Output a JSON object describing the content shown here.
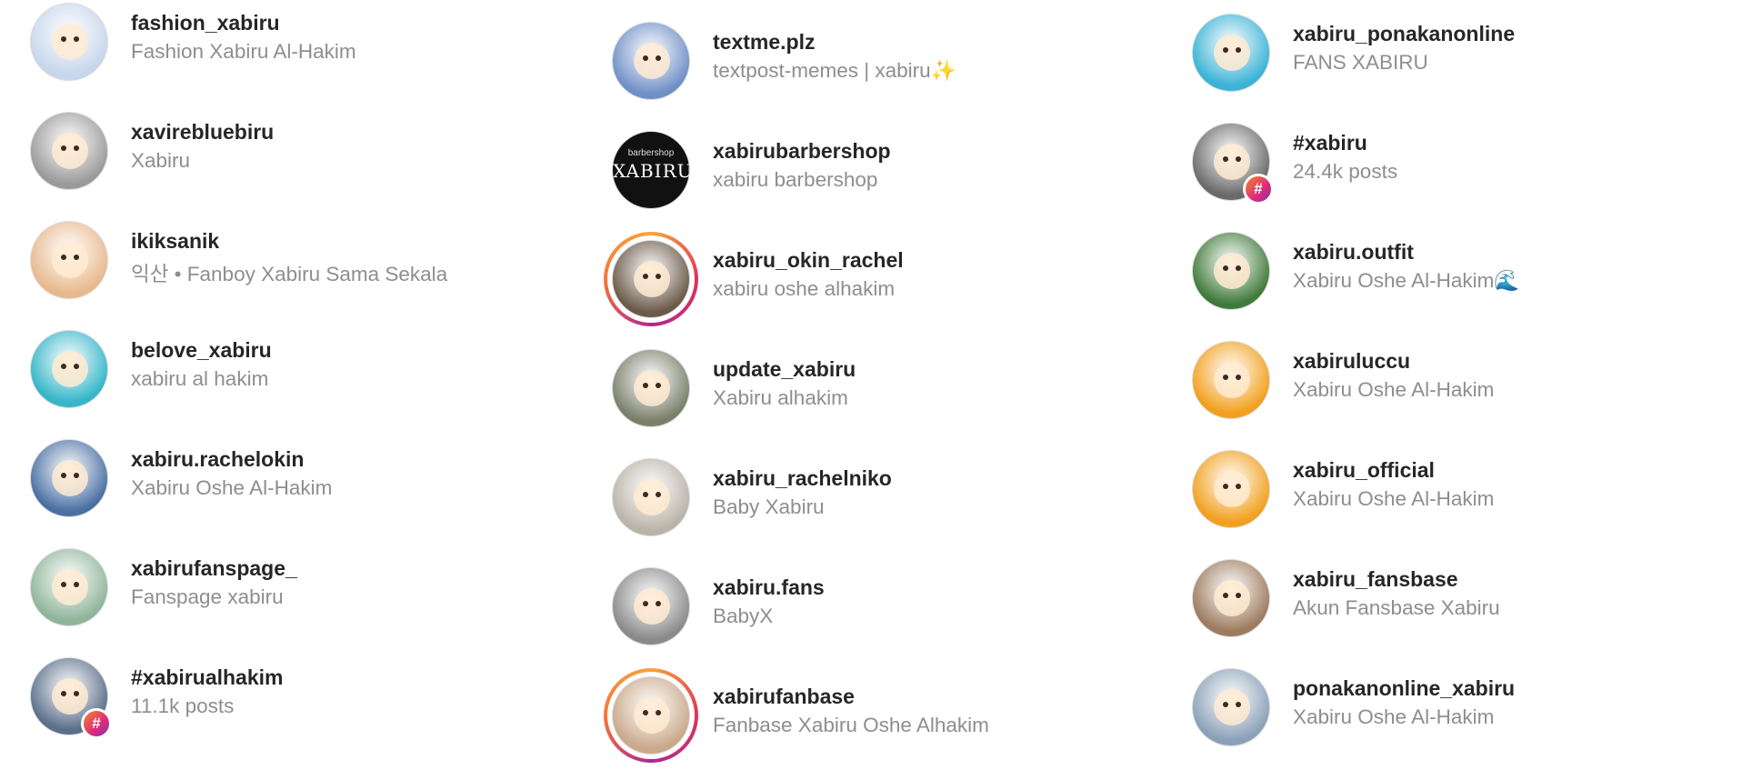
{
  "columns": [
    {
      "rows": [
        {
          "username": "fashion_xabiru",
          "subtitle": "Fashion Xabiru Al-Hakim",
          "avatar_color": "#c7d6ec",
          "avatar_kind": "photo"
        },
        {
          "username": "xavirebluebiru",
          "subtitle": "Xabiru",
          "avatar_color": "#9a9a9a",
          "avatar_kind": "photo"
        },
        {
          "username": "ikiksanik",
          "subtitle": "익산 • Fanboy Xabiru Sama Sekala",
          "avatar_color": "#e8b98d",
          "avatar_kind": "photo"
        },
        {
          "username": "belove_xabiru",
          "subtitle": "xabiru al hakim",
          "avatar_color": "#35b6c9",
          "avatar_kind": "photo"
        },
        {
          "username": "xabiru.rachelokin",
          "subtitle": "Xabiru Oshe Al-Hakim",
          "avatar_color": "#4a6fa3",
          "avatar_kind": "photo"
        },
        {
          "username": "xabirufanspage_",
          "subtitle": "Fanspage xabiru",
          "avatar_color": "#8fb59a",
          "avatar_kind": "photo"
        },
        {
          "username": "#xabirualhakim",
          "subtitle": "11.1k posts",
          "avatar_color": "#5b6f8a",
          "avatar_kind": "hashtag"
        }
      ]
    },
    {
      "rows": [
        {
          "username": "textme.plz",
          "subtitle": "textpost-memes | xabiru✨",
          "avatar_color": "#6f8fc7",
          "avatar_kind": "photo"
        },
        {
          "username": "xabirubarbershop",
          "subtitle": "xabiru barbershop",
          "avatar_color": "#111111",
          "avatar_kind": "logo",
          "logo_text": "XABIRU",
          "logo_small": "barbershop"
        },
        {
          "username": "xabiru_okin_rachel",
          "subtitle": "xabiru oshe alhakim",
          "avatar_color": "#6b5a4a",
          "avatar_kind": "story"
        },
        {
          "username": "update_xabiru",
          "subtitle": "Xabiru alhakim",
          "avatar_color": "#7a7f6a",
          "avatar_kind": "photo"
        },
        {
          "username": "xabiru_rachelniko",
          "subtitle": "Baby Xabiru",
          "avatar_color": "#b9b3a8",
          "avatar_kind": "photo"
        },
        {
          "username": "xabiru.fans",
          "subtitle": "BabyX",
          "avatar_color": "#8a8a8a",
          "avatar_kind": "photo"
        },
        {
          "username": "xabirufanbase",
          "subtitle": "Fanbase Xabiru Oshe Alhakim",
          "avatar_color": "#c9a98a",
          "avatar_kind": "story"
        }
      ]
    },
    {
      "rows": [
        {
          "username": "xabiru_ponakanonline",
          "subtitle": "FANS XABIRU",
          "avatar_color": "#3ab3d6",
          "avatar_kind": "photo"
        },
        {
          "username": "#xabiru",
          "subtitle": "24.4k posts",
          "avatar_color": "#6a6a6a",
          "avatar_kind": "hashtag"
        },
        {
          "username": "xabiru.outfit",
          "subtitle": "Xabiru Oshe Al-Hakim🌊",
          "avatar_color": "#3f7a3a",
          "avatar_kind": "photo"
        },
        {
          "username": "xabiruluccu",
          "subtitle": "Xabiru Oshe Al-Hakim",
          "avatar_color": "#f2a01e",
          "avatar_kind": "photo"
        },
        {
          "username": "xabiru_official",
          "subtitle": "Xabiru Oshe Al-Hakim",
          "avatar_color": "#f2a01e",
          "avatar_kind": "photo"
        },
        {
          "username": "xabiru_fansbase",
          "subtitle": "Akun Fansbase Xabiru",
          "avatar_color": "#9c7b5e",
          "avatar_kind": "photo"
        },
        {
          "username": "ponakanonline_xabiru",
          "subtitle": "Xabiru Oshe Al-Hakim",
          "avatar_color": "#8aa0b8",
          "avatar_kind": "photo"
        }
      ]
    }
  ]
}
